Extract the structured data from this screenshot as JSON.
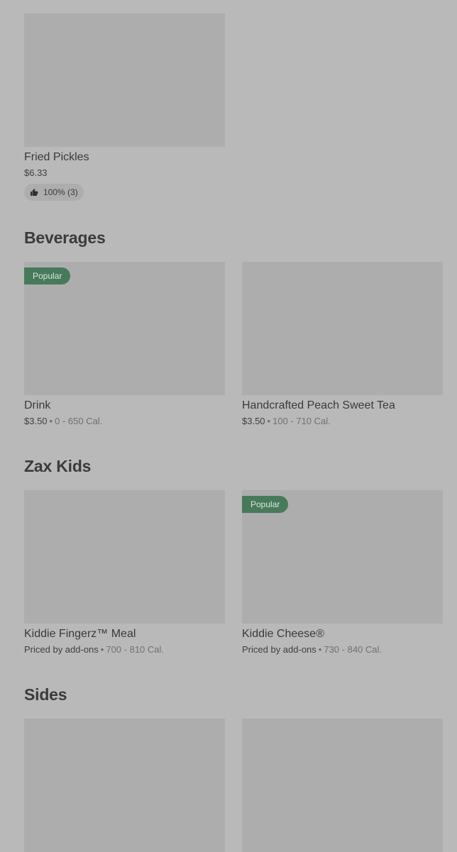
{
  "top_item": {
    "name": "Fried Pickles",
    "price": "$6.33",
    "rating": "100% (3)",
    "rating_icon": "thumbs-up-icon"
  },
  "sections": [
    {
      "title": "Beverages",
      "items": [
        {
          "badge": "Popular",
          "name": "Drink",
          "price": "$3.50",
          "separator": "•",
          "calories": "0 - 650 Cal."
        },
        {
          "name": "Handcrafted Peach Sweet Tea",
          "price": "$3.50",
          "separator": "•",
          "calories": "100 - 710 Cal."
        }
      ]
    },
    {
      "title": "Zax Kids",
      "items": [
        {
          "name": "Kiddie Fingerz™ Meal",
          "price": "Priced by add-ons",
          "separator": "•",
          "calories": "700 - 810 Cal."
        },
        {
          "badge": "Popular",
          "name": "Kiddie Cheese®",
          "price": "Priced by add-ons",
          "separator": "•",
          "calories": "730 - 840 Cal."
        }
      ]
    },
    {
      "title": "Sides",
      "items": [
        {},
        {}
      ]
    }
  ],
  "colors": {
    "background": "#b9b9b9",
    "image_placeholder": "#adadad",
    "badge": "#477a5a"
  }
}
